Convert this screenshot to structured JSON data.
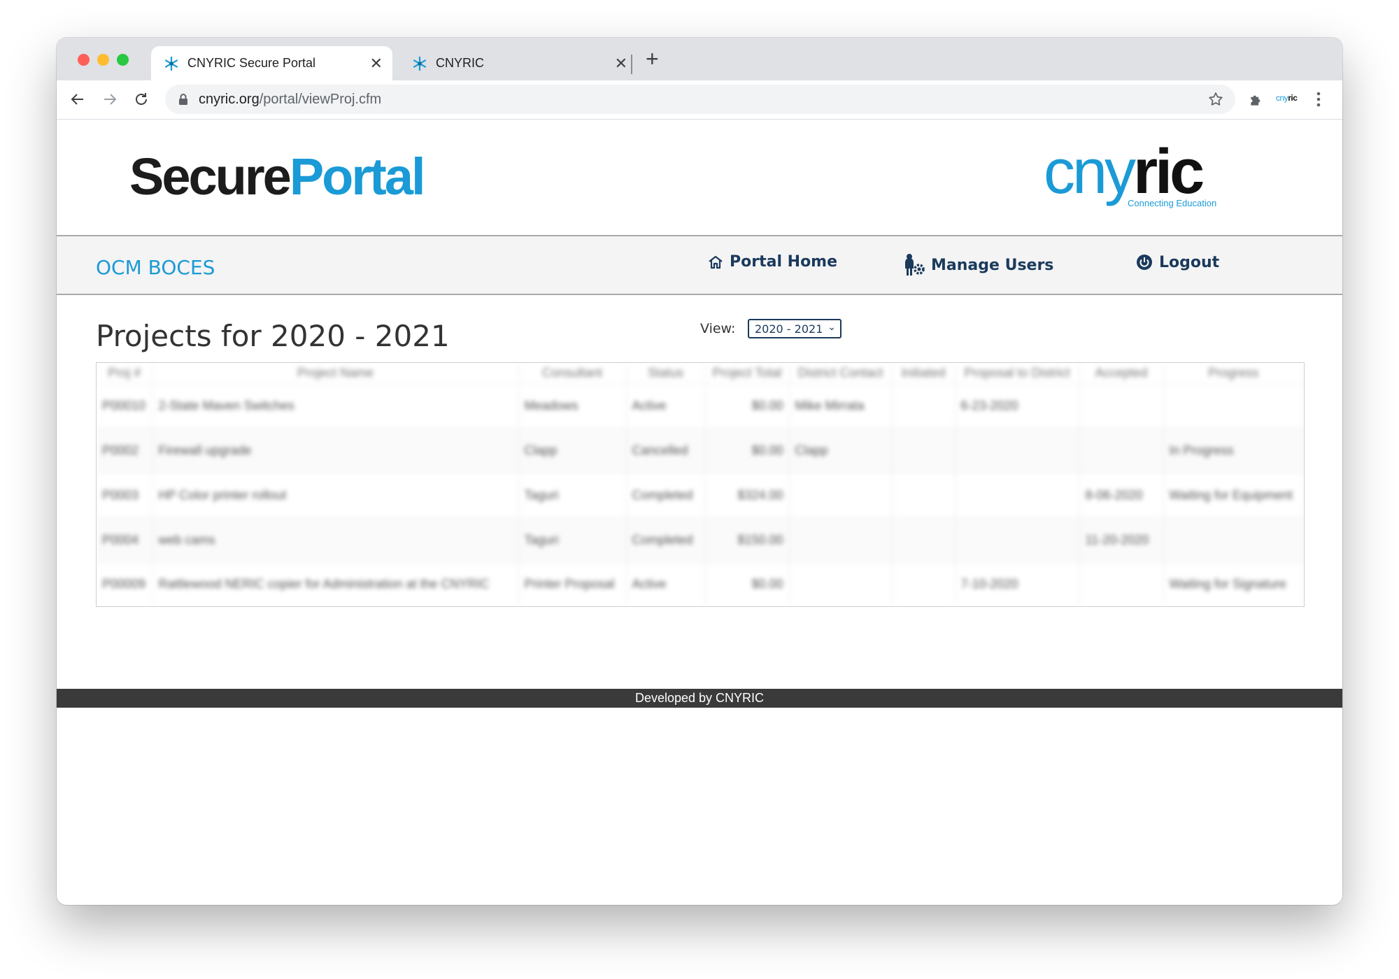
{
  "browser": {
    "tabs": [
      {
        "title": "CNYRIC Secure Portal",
        "active": true
      },
      {
        "title": "CNYRIC",
        "active": false
      }
    ],
    "url_domain": "cnyric.org",
    "url_path": "/portal/viewProj.cfm",
    "extension_label_a": "cny",
    "extension_label_b": "ric"
  },
  "brand": {
    "logo_secure": "Secure",
    "logo_portal": "Portal",
    "partner_cny": "cny",
    "partner_ric": "ric",
    "partner_tagline": "Connecting Education"
  },
  "nav": {
    "org_name": "OCM BOCES",
    "portal_home": "Portal Home",
    "manage_users": "Manage Users",
    "logout": "Logout"
  },
  "main": {
    "heading": "Projects for 2020 - 2021",
    "view_label": "View:",
    "view_selected": "2020 - 2021"
  },
  "table": {
    "headers": [
      "Proj #",
      "Project Name",
      "Consultant",
      "Status",
      "Project Total",
      "District Contact",
      "Initiated",
      "Proposal to District",
      "Accepted",
      "Progress"
    ],
    "rows": [
      [
        "P00010",
        "2-State Maven Switches",
        "Meadows",
        "Active",
        "$0.00",
        "Mike Mirrata",
        "",
        "6-23-2020",
        "",
        ""
      ],
      [
        "P0002",
        "Firewall upgrade",
        "Clapp",
        "Cancelled",
        "$0.00",
        "Clapp",
        "",
        "",
        "",
        "In Progress"
      ],
      [
        "P0003",
        "HP Color printer rollout",
        "Taguri",
        "Completed",
        "$324.00",
        "",
        "",
        "",
        "8-06-2020",
        "Waiting for Equipment"
      ],
      [
        "P0004",
        "web cams",
        "Taguri",
        "Completed",
        "$150.00",
        "",
        "",
        "",
        "11-20-2020",
        ""
      ],
      [
        "P00009",
        "Rattlewood NERIC copier for Administration at the CNYRIC",
        "Printer Proposal",
        "Active",
        "$0.00",
        "",
        "",
        "7-10-2020",
        "",
        "Waiting for Signature"
      ]
    ]
  },
  "footer": {
    "text": "Developed by CNYRIC"
  }
}
